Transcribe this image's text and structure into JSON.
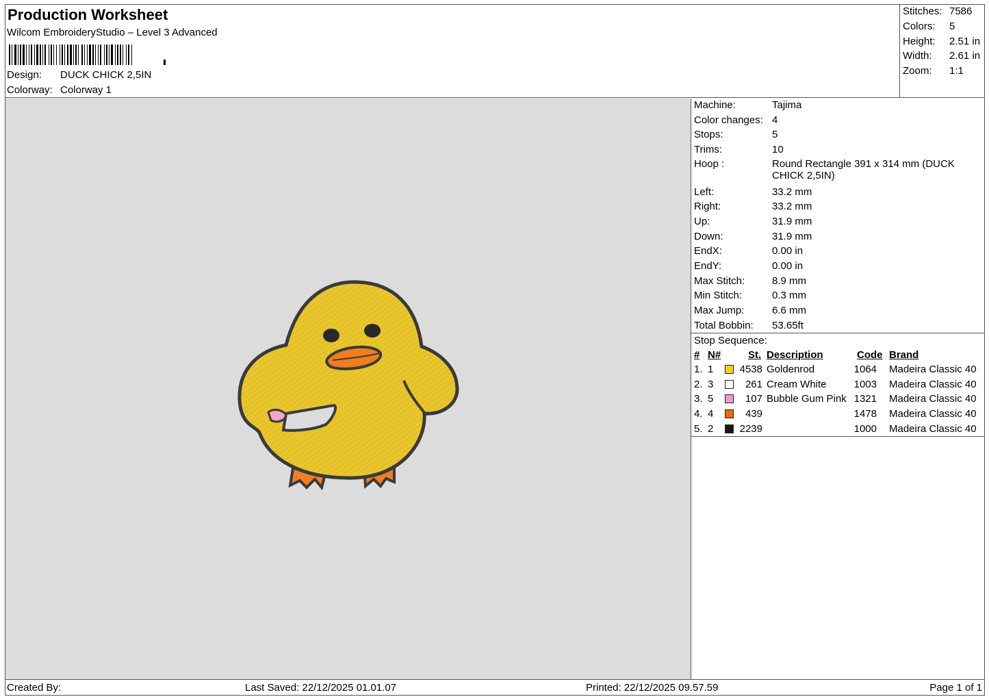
{
  "header": {
    "title": "Production Worksheet",
    "software": "Wilcom EmbroideryStudio – Level 3 Advanced",
    "design_label": "Design:",
    "design_value": "DUCK CHICK 2,5IN",
    "colorway_label": "Colorway:",
    "colorway_value": "Colorway 1"
  },
  "stats": {
    "stitches_label": "Stitches:",
    "stitches": "7586",
    "colors_label": "Colors:",
    "colors": "5",
    "height_label": "Height:",
    "height": "2.51 in",
    "width_label": "Width:",
    "width": "2.61 in",
    "zoom_label": "Zoom:",
    "zoom": "1:1"
  },
  "info": {
    "machine_label": "Machine:",
    "machine": "Tajima",
    "color_changes_label": "Color changes:",
    "color_changes": "4",
    "stops_label": "Stops:",
    "stops": "5",
    "trims_label": "Trims:",
    "trims": "10",
    "hoop_label": "Hoop :",
    "hoop": "Round Rectangle 391 x 314 mm (DUCK CHICK 2,5IN)",
    "left_label": "Left:",
    "left": "33.2 mm",
    "right_label": "Right:",
    "right": "33.2 mm",
    "up_label": "Up:",
    "up": "31.9 mm",
    "down_label": "Down:",
    "down": "31.9 mm",
    "endx_label": "EndX:",
    "endx": "0.00 in",
    "endy_label": "EndY:",
    "endy": "0.00 in",
    "max_stitch_label": "Max Stitch:",
    "max_stitch": "8.9 mm",
    "min_stitch_label": "Min Stitch:",
    "min_stitch": "0.3 mm",
    "max_jump_label": "Max Jump:",
    "max_jump": "6.6 mm",
    "total_bobbin_label": "Total Bobbin:",
    "total_bobbin": "53.65ft"
  },
  "stop_sequence": {
    "title": "Stop Sequence:",
    "headers": {
      "num": "#",
      "n": "N#",
      "st": "St.",
      "description": "Description",
      "code": "Code",
      "brand": "Brand"
    },
    "rows": [
      {
        "num": "1.",
        "n": "1",
        "color": "#f5d020",
        "st": "4538",
        "description": "Goldenrod",
        "code": "1064",
        "brand": "Madeira Classic 40"
      },
      {
        "num": "2.",
        "n": "3",
        "color": "#ffffff",
        "st": "261",
        "description": "Cream White",
        "code": "1003",
        "brand": "Madeira Classic 40"
      },
      {
        "num": "3.",
        "n": "5",
        "color": "#e8a0c8",
        "st": "107",
        "description": "Bubble Gum Pink",
        "code": "1321",
        "brand": "Madeira Classic 40"
      },
      {
        "num": "4.",
        "n": "4",
        "color": "#f06a10",
        "st": "439",
        "description": "",
        "code": "1478",
        "brand": "Madeira Classic 40"
      },
      {
        "num": "5.",
        "n": "2",
        "color": "#1a1a1a",
        "st": "2239",
        "description": "",
        "code": "1000",
        "brand": "Madeira Classic 40"
      }
    ]
  },
  "footer": {
    "created_by": "Created By:",
    "last_saved": "Last Saved: 22/12/2025 01.01.07",
    "printed": "Printed: 22/12/2025 09.57.59",
    "page": "Page 1 of 1"
  },
  "colors": {
    "canvas_bg": "#dcdcdc",
    "body_yellow": "#e8c52a",
    "outline": "#3a3a3a",
    "beak": "#f07d20"
  }
}
